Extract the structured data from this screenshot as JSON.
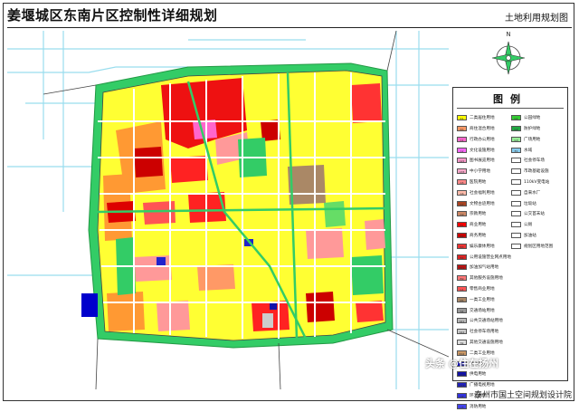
{
  "header": {
    "title": "姜堰城区东南片区控制性详细规划",
    "subtitle": "土地利用规划图"
  },
  "compass": {
    "north_label": "N"
  },
  "legend": {
    "title": "图例",
    "items_left": [
      {
        "code": "R1",
        "label": "二类居住用地",
        "color": "#ffff00"
      },
      {
        "code": "Rb",
        "label": "商住混合用地",
        "color": "#ff9966"
      },
      {
        "code": "A1",
        "label": "行政办公用地",
        "color": "#ff66cc"
      },
      {
        "code": "A2",
        "label": "文化设施用地",
        "color": "#ff66ff"
      },
      {
        "code": "A22",
        "label": "图书展览用地",
        "color": "#ff99cc"
      },
      {
        "code": "A33",
        "label": "中小学用地",
        "color": "#ffaacc"
      },
      {
        "code": "A5",
        "label": "医院用地",
        "color": "#ff8888"
      },
      {
        "code": "A6",
        "label": "社会福利用地",
        "color": "#ffbbaa"
      },
      {
        "code": "A7",
        "label": "文物古迹用地",
        "color": "#aa4422"
      },
      {
        "code": "A9",
        "label": "宗教用地",
        "color": "#cc8866"
      },
      {
        "code": "B1",
        "label": "商业用地",
        "color": "#ff0000"
      },
      {
        "code": "B2",
        "label": "商务用地",
        "color": "#cc0000"
      },
      {
        "code": "B3",
        "label": "娱乐康体用地",
        "color": "#ee3333"
      },
      {
        "code": "B4",
        "label": "公用设施营业网点用地",
        "color": "#dd2222"
      },
      {
        "code": "B41",
        "label": "加油加气站用地",
        "color": "#bb1111"
      },
      {
        "code": "B9",
        "label": "其他服务设施用地",
        "color": "#ff7777"
      },
      {
        "code": "G1",
        "label": "零售商业用地",
        "color": "#ff5555"
      },
      {
        "code": "M1",
        "label": "一类工业用地",
        "color": "#aa8866"
      },
      {
        "code": "S4",
        "label": "交通场站用地",
        "color": "#999999"
      },
      {
        "code": "S41",
        "label": "公共交通场站用地",
        "color": "#bbbbbb"
      },
      {
        "code": "S42",
        "label": "社会停车场用地",
        "color": "#cccccc"
      },
      {
        "code": "S9",
        "label": "其他交通设施用地",
        "color": "#dddddd"
      },
      {
        "code": "Rb2",
        "label": "二类工业用地",
        "color": "#cc9966"
      },
      {
        "code": "U1",
        "label": "供水用地",
        "color": "#0000cc"
      },
      {
        "code": "U12",
        "label": "供电用地",
        "color": "#1111aa"
      },
      {
        "code": "U15",
        "label": "广播电视用地",
        "color": "#2222bb"
      },
      {
        "code": "U2",
        "label": "环卫用地",
        "color": "#3333dd"
      },
      {
        "code": "U3",
        "label": "消防用地",
        "color": "#4444ee"
      }
    ],
    "items_right": [
      {
        "code": "G1",
        "label": "公园绿地",
        "color": "#33cc33"
      },
      {
        "code": "G2",
        "label": "防护绿地",
        "color": "#22aa44"
      },
      {
        "code": "G3",
        "label": "广场用地",
        "color": "#99ee99"
      },
      {
        "code": "E1",
        "label": "水域",
        "color": "#88ccee"
      },
      {
        "code": "",
        "label": "社会停车场",
        "color": "#ffffff"
      },
      {
        "code": "",
        "label": "市政基础设施",
        "color": "#ffffff"
      },
      {
        "code": "",
        "label": "110kV变电站",
        "color": "#ffffff"
      },
      {
        "code": "",
        "label": "自来水厂",
        "color": "#ffffff"
      },
      {
        "code": "",
        "label": "垃圾站",
        "color": "#ffffff"
      },
      {
        "code": "",
        "label": "公交首末站",
        "color": "#ffffff"
      },
      {
        "code": "",
        "label": "公厕",
        "color": "#ffffff"
      },
      {
        "code": "",
        "label": "加油站",
        "color": "#ffffff"
      },
      {
        "code": "",
        "label": "规划区用地范围",
        "color": "#ffffff"
      }
    ]
  },
  "watermark": "头条 @住在扬州",
  "footer": "泰州市国土空间规划设计院",
  "colors": {
    "road": "#ffffff",
    "greenbelt": "#33cc66",
    "water": "#99ddee",
    "boundary": "#444444"
  }
}
